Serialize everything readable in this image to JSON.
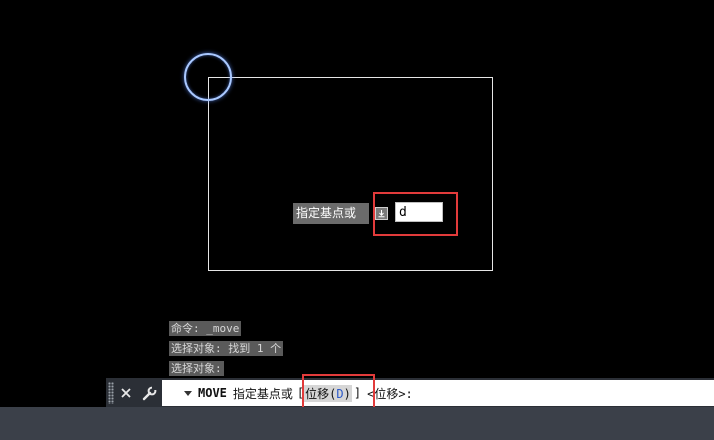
{
  "drawing": {
    "rectangle": {
      "color": "#e6e6e6"
    },
    "circle_highlight": {
      "color": "#a9c8ff"
    }
  },
  "dynamic_input": {
    "prompt": "指定基点或",
    "value": "d",
    "arrow_icon": "down-arrow-icon"
  },
  "history": [
    "命令: _move",
    "选择对象: 找到 1 个",
    "选择对象:"
  ],
  "command_line": {
    "close_icon": "close-icon",
    "settings_icon": "wrench-icon",
    "dropdown_icon": "chevron-down-icon",
    "command": "MOVE",
    "prompt": "指定基点或",
    "bracket_open": "[",
    "option_text": "位移(",
    "option_key": "D",
    "option_close": ")",
    "bracket_close": "]",
    "default": "<位移>:"
  },
  "colors": {
    "background": "#000000",
    "highlight_box": "#e23b3b",
    "option_key": "#2a58c9",
    "command_bar": "#2b2f36"
  }
}
